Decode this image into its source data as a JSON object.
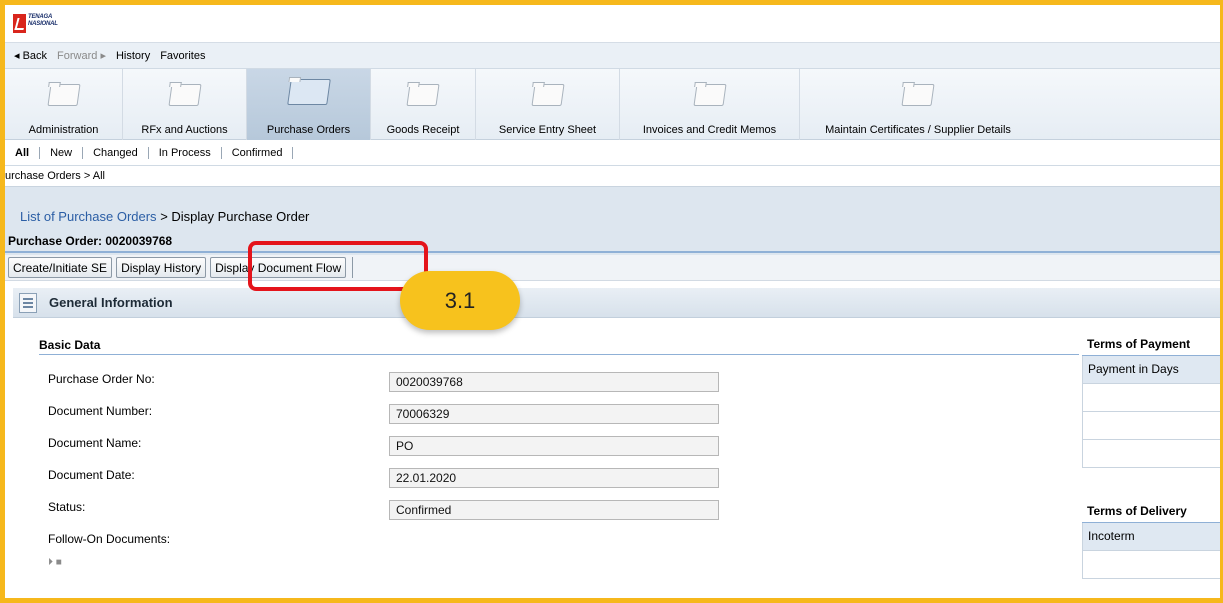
{
  "logo": {
    "line1": "TENAGA",
    "line2": "NASIONAL",
    "color": "#d9251c"
  },
  "history_bar": {
    "back": "◂ Back",
    "forward": "Forward ▸",
    "history": "History",
    "favorites": "Favorites"
  },
  "tabs": [
    {
      "label": "Administration"
    },
    {
      "label": "RFx and Auctions"
    },
    {
      "label": "Purchase Orders",
      "active": true
    },
    {
      "label": "Goods Receipt"
    },
    {
      "label": "Service Entry Sheet"
    },
    {
      "label": "Invoices and Credit Memos"
    },
    {
      "label": "Maintain Certificates / Supplier Details"
    }
  ],
  "subtabs": [
    "All",
    "New",
    "Changed",
    "In Process",
    "Confirmed"
  ],
  "breadcrumb": "urchase Orders  >  All",
  "page": {
    "path_link": "List of Purchase Orders",
    "path_current": ">  Display Purchase Order",
    "title": "Purchase Order: 0020039768"
  },
  "toolbar": {
    "create_se": "Create/Initiate SE",
    "display_history": "Display History",
    "display_doc_flow": "Display Document Flow"
  },
  "annotation": {
    "label": "3.1",
    "highlight_color": "#e4141b",
    "badge_color": "#f7c21d"
  },
  "section": {
    "title": "General Information",
    "basic_data": "Basic Data"
  },
  "basic_data": [
    {
      "label": "Purchase Order No:",
      "value": "0020039768"
    },
    {
      "label": "Document Number:",
      "value": "70006329"
    },
    {
      "label": "Document Name:",
      "value": "PO"
    },
    {
      "label": "Document Date:",
      "value": "22.01.2020"
    },
    {
      "label": "Status:",
      "value": "Confirmed"
    }
  ],
  "follow_on": {
    "label": "Follow-On Documents:",
    "icons": "⏵ ■"
  },
  "terms_payment": {
    "title": "Terms of Payment",
    "header": "Payment in Days"
  },
  "terms_delivery": {
    "title": "Terms of Delivery",
    "header": "Incoterm"
  }
}
